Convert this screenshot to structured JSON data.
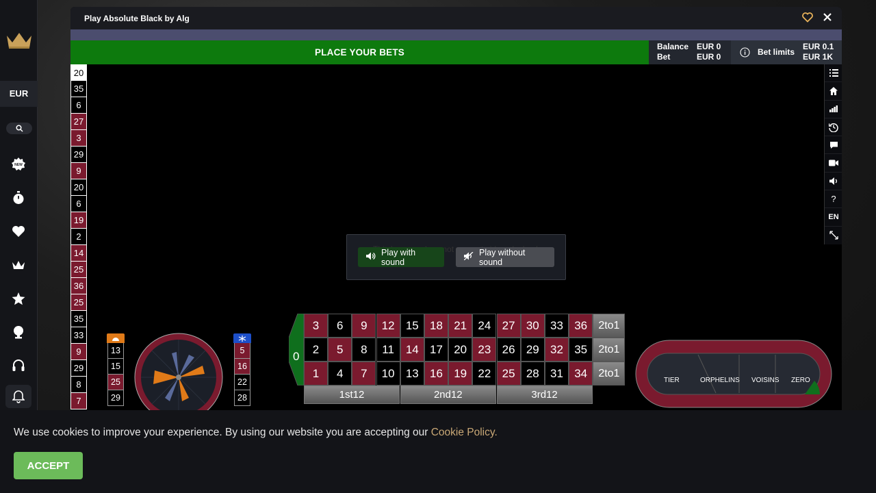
{
  "sidebar": {
    "currency": "EUR",
    "icons": [
      "crown-logo-icon",
      "search-icon",
      "new-badge-icon",
      "timer-icon",
      "heart-icon",
      "crown-icon",
      "star-icon",
      "trophy-icon",
      "headset-icon",
      "bell-icon"
    ]
  },
  "window": {
    "title": "Play Absolute Black by Alg"
  },
  "betbar": {
    "label": "PLACE YOUR BETS"
  },
  "info": {
    "balance_label": "Balance",
    "bet_label": "Bet",
    "balance_value": "EUR 0",
    "bet_value": "EUR 0",
    "limits_label": "Bet limits",
    "limit_min": "EUR 0.1",
    "limit_max": "EUR 1K"
  },
  "history": [
    {
      "n": "20",
      "c": "first"
    },
    {
      "n": "35",
      "c": "black"
    },
    {
      "n": "6",
      "c": "black"
    },
    {
      "n": "27",
      "c": "red"
    },
    {
      "n": "3",
      "c": "red"
    },
    {
      "n": "29",
      "c": "black"
    },
    {
      "n": "9",
      "c": "red"
    },
    {
      "n": "20",
      "c": "black"
    },
    {
      "n": "6",
      "c": "black"
    },
    {
      "n": "19",
      "c": "red"
    },
    {
      "n": "2",
      "c": "black"
    },
    {
      "n": "14",
      "c": "red"
    },
    {
      "n": "25",
      "c": "red"
    },
    {
      "n": "36",
      "c": "red"
    },
    {
      "n": "25",
      "c": "red"
    },
    {
      "n": "35",
      "c": "black"
    },
    {
      "n": "33",
      "c": "black"
    },
    {
      "n": "9",
      "c": "red"
    },
    {
      "n": "29",
      "c": "black"
    },
    {
      "n": "8",
      "c": "black"
    },
    {
      "n": "7",
      "c": "red"
    }
  ],
  "toolbar": {
    "lang": "EN"
  },
  "sound_dialog": {
    "ghost_text": "This browser does not support video playback",
    "with_sound": "Play with sound",
    "without_sound": "Play without sound"
  },
  "hot_numbers": [
    {
      "n": "13",
      "c": "black"
    },
    {
      "n": "15",
      "c": "black"
    },
    {
      "n": "25",
      "c": "red"
    },
    {
      "n": "29",
      "c": "black"
    }
  ],
  "cold_numbers": [
    {
      "n": "5",
      "c": "red"
    },
    {
      "n": "16",
      "c": "red"
    },
    {
      "n": "22",
      "c": "black"
    },
    {
      "n": "28",
      "c": "black"
    }
  ],
  "table": {
    "zero": "0",
    "rows": [
      [
        {
          "n": "3",
          "c": "red"
        },
        {
          "n": "6",
          "c": "black"
        },
        {
          "n": "9",
          "c": "red"
        },
        {
          "n": "12",
          "c": "red"
        },
        {
          "n": "15",
          "c": "black"
        },
        {
          "n": "18",
          "c": "red"
        },
        {
          "n": "21",
          "c": "red"
        },
        {
          "n": "24",
          "c": "black"
        },
        {
          "n": "27",
          "c": "red"
        },
        {
          "n": "30",
          "c": "red"
        },
        {
          "n": "33",
          "c": "black"
        },
        {
          "n": "36",
          "c": "red"
        }
      ],
      [
        {
          "n": "2",
          "c": "black"
        },
        {
          "n": "5",
          "c": "red"
        },
        {
          "n": "8",
          "c": "black"
        },
        {
          "n": "11",
          "c": "black"
        },
        {
          "n": "14",
          "c": "red"
        },
        {
          "n": "17",
          "c": "black"
        },
        {
          "n": "20",
          "c": "black"
        },
        {
          "n": "23",
          "c": "red"
        },
        {
          "n": "26",
          "c": "black"
        },
        {
          "n": "29",
          "c": "black"
        },
        {
          "n": "32",
          "c": "red"
        },
        {
          "n": "35",
          "c": "black"
        }
      ],
      [
        {
          "n": "1",
          "c": "red"
        },
        {
          "n": "4",
          "c": "black"
        },
        {
          "n": "7",
          "c": "red"
        },
        {
          "n": "10",
          "c": "black"
        },
        {
          "n": "13",
          "c": "black"
        },
        {
          "n": "16",
          "c": "red"
        },
        {
          "n": "19",
          "c": "red"
        },
        {
          "n": "22",
          "c": "black"
        },
        {
          "n": "25",
          "c": "red"
        },
        {
          "n": "28",
          "c": "black"
        },
        {
          "n": "31",
          "c": "black"
        },
        {
          "n": "34",
          "c": "red"
        }
      ]
    ],
    "column_bet": "2to1",
    "dozens": [
      "1st12",
      "2nd12",
      "3rd12"
    ]
  },
  "racetrack": {
    "sections": [
      "TIER",
      "ORPHELINS",
      "VOISINS",
      "ZERO"
    ]
  },
  "cookie": {
    "message": "We use cookies to improve your experience. By using our website you are accepting our ",
    "link": "Cookie Policy.",
    "accept": "ACCEPT"
  },
  "colors": {
    "red": "#7a1a2e",
    "green": "#0d7a0d",
    "accent_gold": "#c9a876",
    "accept_green": "#6cbb5a"
  }
}
